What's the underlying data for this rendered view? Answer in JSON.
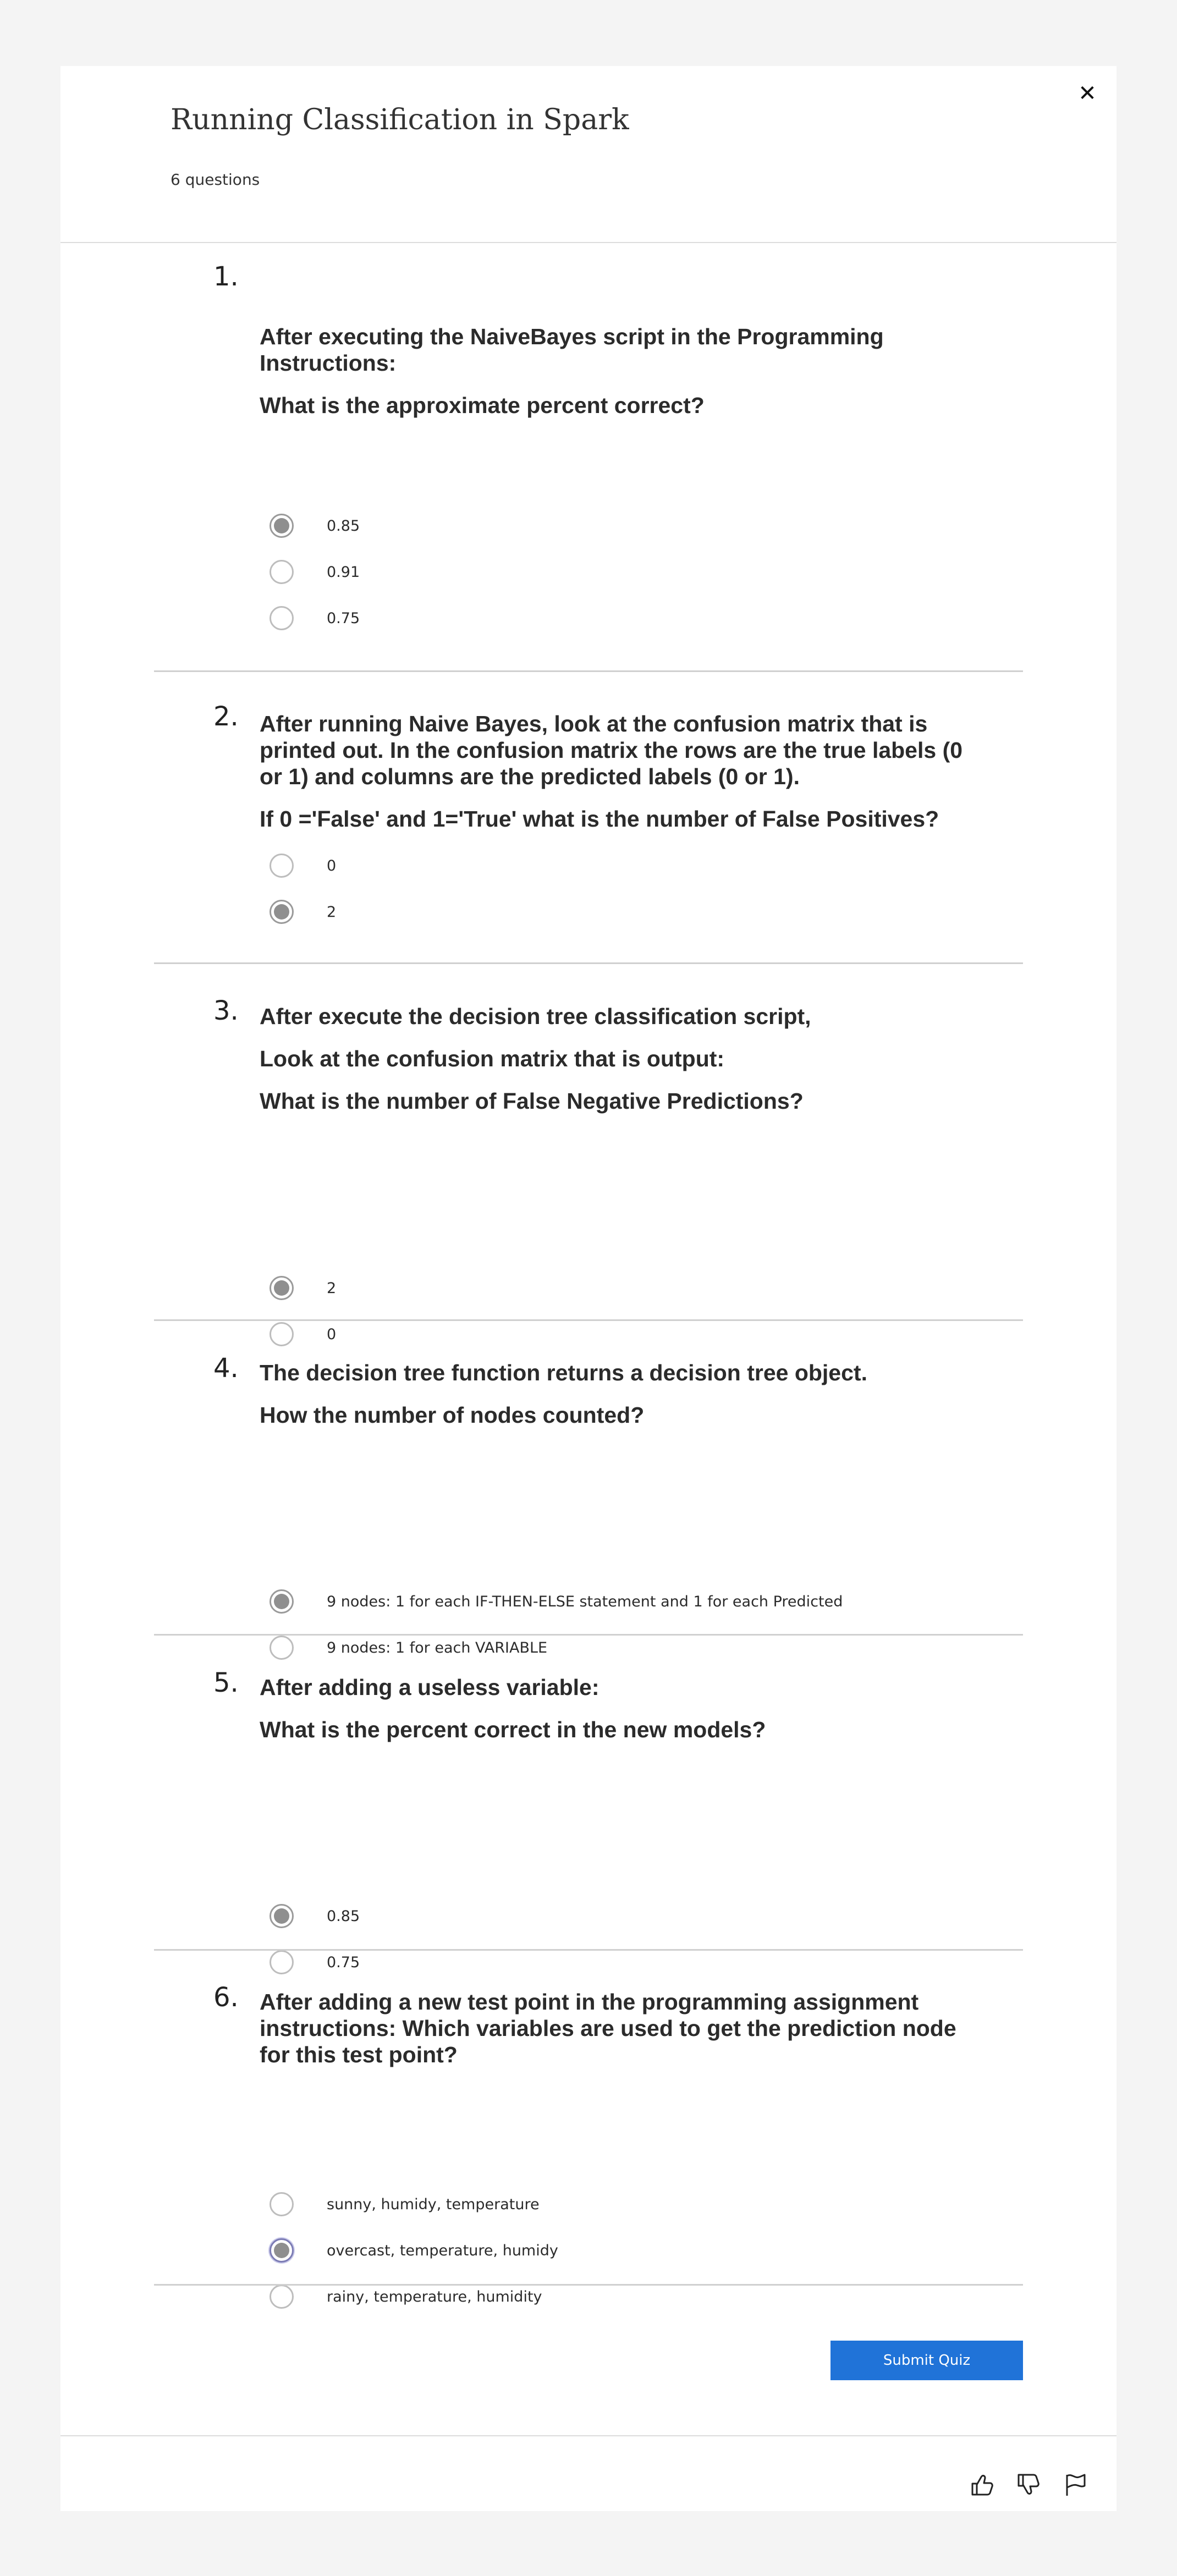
{
  "quiz": {
    "title": "Running Classification in Spark",
    "question_count": "6 questions",
    "close_icon": "close-icon",
    "submit_label": "Submit Quiz"
  },
  "questions": [
    {
      "number": "1.",
      "text": [
        "After executing the NaiveBayes script in the Programming Instructions:",
        "What is the approximate percent correct?"
      ],
      "options": [
        {
          "label": "0.85",
          "selected": true
        },
        {
          "label": "0.91",
          "selected": false
        },
        {
          "label": "0.75",
          "selected": false
        }
      ]
    },
    {
      "number": "2.",
      "text": [
        "After running Naive Bayes, look at the confusion matrix that is printed out. In the confusion matrix the rows are the true labels (0 or 1) and columns are the predicted labels (0 or 1).",
        "If 0 ='False' and 1='True' what is the number of False Positives?"
      ],
      "options": [
        {
          "label": "0",
          "selected": false
        },
        {
          "label": "2",
          "selected": true
        }
      ]
    },
    {
      "number": "3.",
      "text": [
        "After execute the decision tree classification script,",
        "Look at the confusion matrix that is output:",
        "What is the number of False Negative Predictions?"
      ],
      "options": [
        {
          "label": "2",
          "selected": true
        },
        {
          "label": "0",
          "selected": false
        }
      ]
    },
    {
      "number": "4.",
      "text": [
        "The decision tree function returns a decision tree object.",
        "How the number of nodes counted?"
      ],
      "options": [
        {
          "label": "9 nodes: 1 for each IF-THEN-ELSE statement and 1 for each Predicted",
          "selected": true
        },
        {
          "label": "9 nodes: 1 for each VARIABLE",
          "selected": false
        }
      ]
    },
    {
      "number": "5.",
      "text": [
        "After adding a useless variable:",
        "What is the percent correct in the new models?"
      ],
      "options": [
        {
          "label": "0.85",
          "selected": true
        },
        {
          "label": "0.75",
          "selected": false
        }
      ]
    },
    {
      "number": "6.",
      "text": [
        "After adding a new test point in the programming assignment instructions: Which variables are used to get the prediction node for this test point?"
      ],
      "options": [
        {
          "label": "sunny, humidy, temperature",
          "selected": false
        },
        {
          "label": "overcast, temperature, humidy",
          "selected": true,
          "focused": true
        },
        {
          "label": "rainy, temperature, humidity",
          "selected": false
        }
      ]
    }
  ],
  "footer": {
    "icons": [
      "thumbs-up-icon",
      "thumbs-down-icon",
      "flag-icon"
    ]
  }
}
